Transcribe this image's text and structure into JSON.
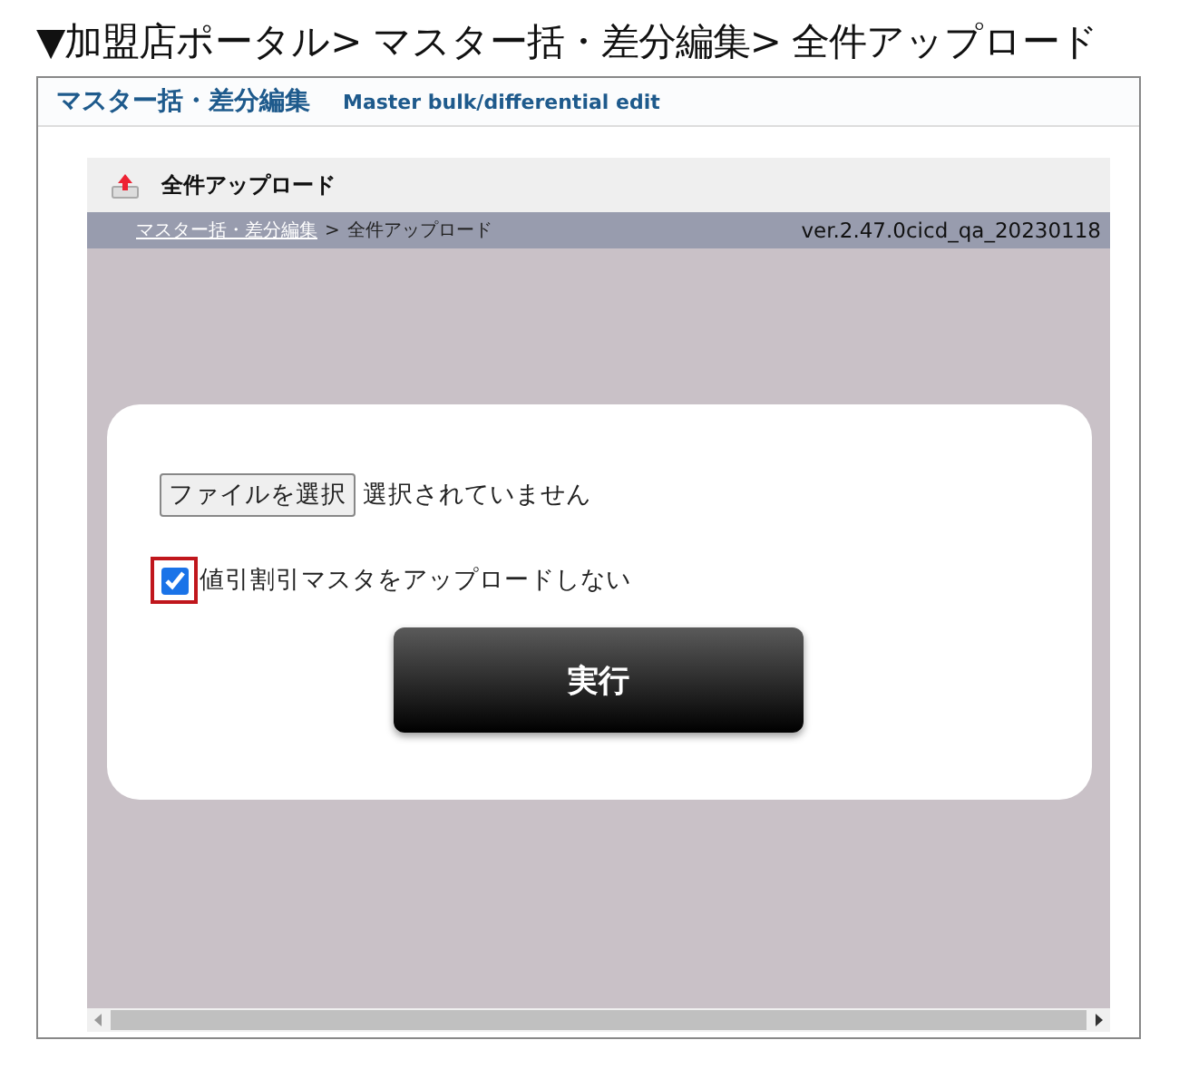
{
  "caption": "▼加盟店ポータル> マスター括・差分編集> 全件アップロード",
  "header": {
    "title": "マスター括・差分編集",
    "subtitle": "Master bulk/differential edit"
  },
  "panel": {
    "title": "全件アップロード",
    "breadcrumb": {
      "link": "マスター括・差分編集",
      "separator": ">",
      "current": "全件アップロード"
    },
    "version": "ver.2.47.0cicd_qa_20230118"
  },
  "form": {
    "file_button": "ファイルを選択",
    "file_status": "選択されていません",
    "checkbox": {
      "label": "値引割引マスタをアップロードしない",
      "checked": true,
      "highlighted": true
    },
    "submit": "実行"
  }
}
